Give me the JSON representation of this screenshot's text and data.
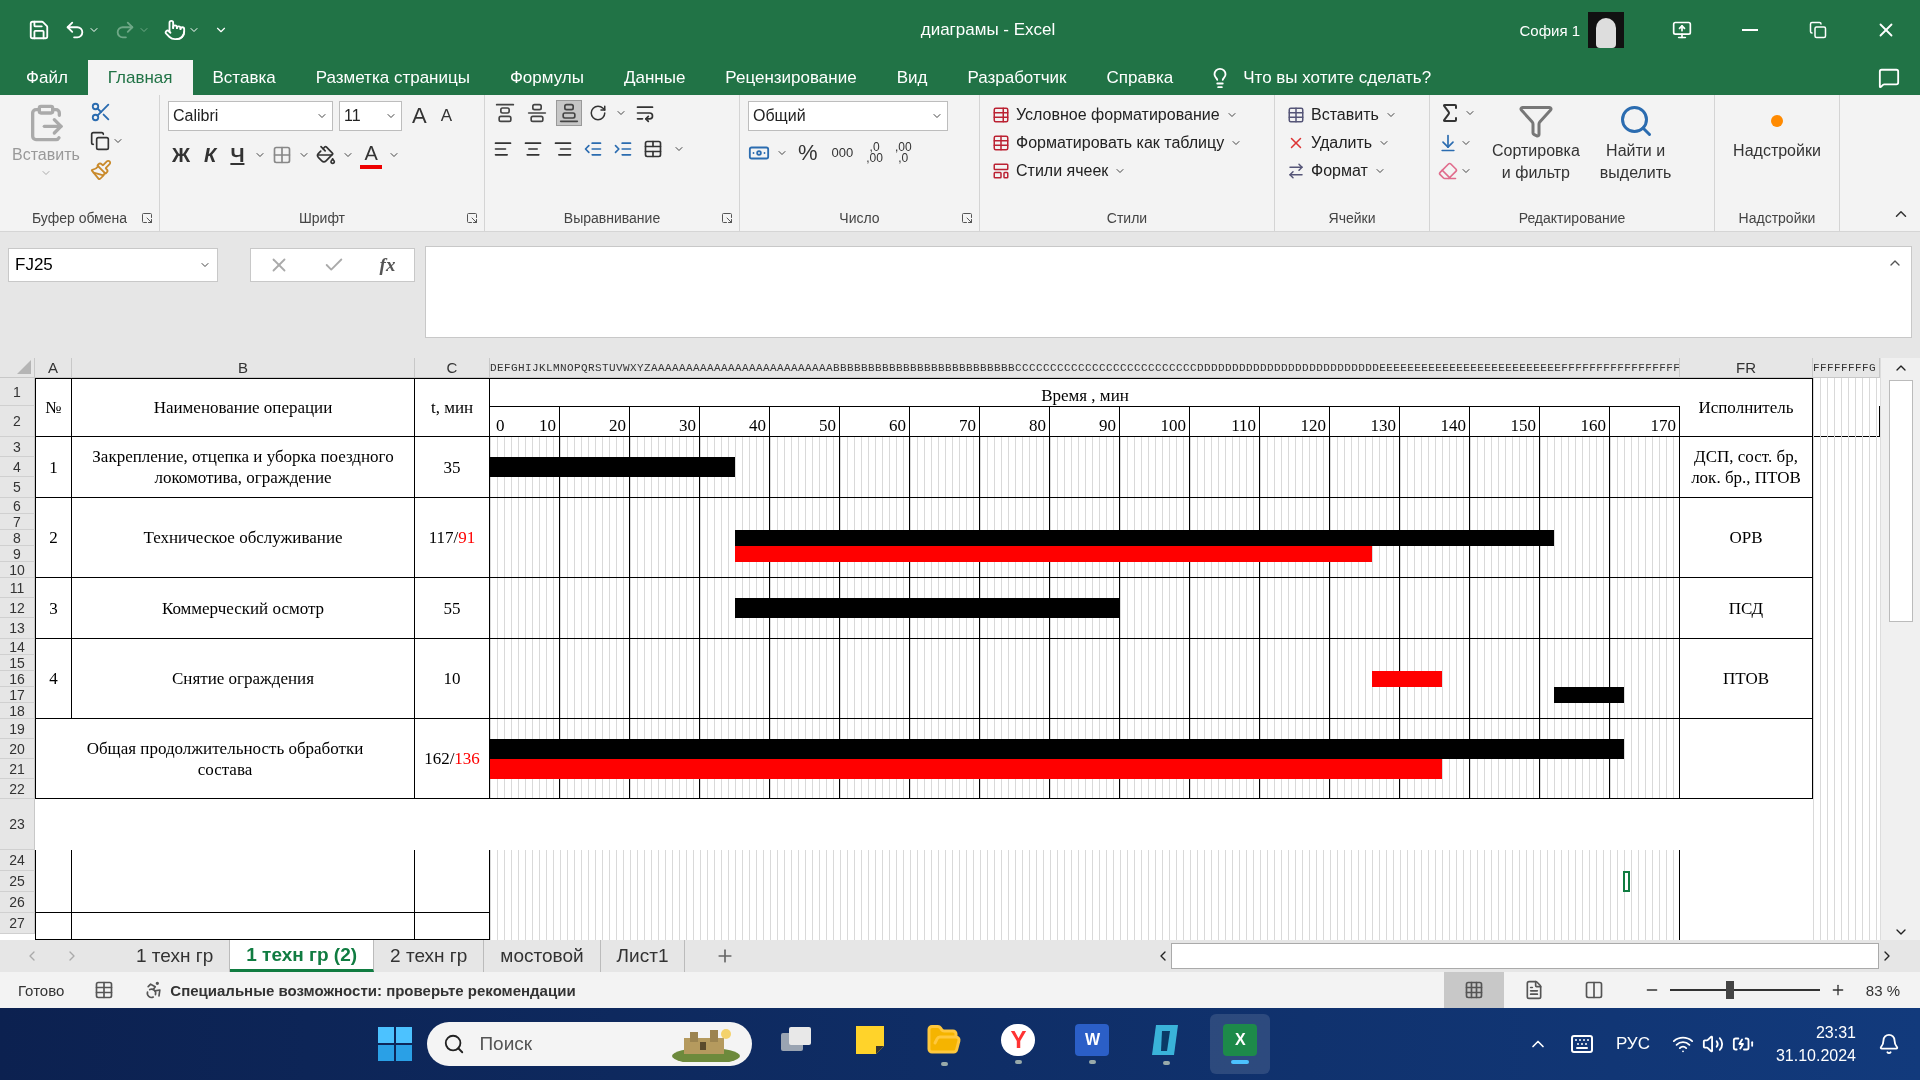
{
  "title_bar": {
    "title": "диаграмы  -  Excel",
    "user": "София 1"
  },
  "menu_tabs": [
    {
      "label": "Файл",
      "selected": false
    },
    {
      "label": "Главная",
      "selected": true
    },
    {
      "label": "Вставка",
      "selected": false
    },
    {
      "label": "Разметка страницы",
      "selected": false
    },
    {
      "label": "Формулы",
      "selected": false
    },
    {
      "label": "Данные",
      "selected": false
    },
    {
      "label": "Рецензирование",
      "selected": false
    },
    {
      "label": "Вид",
      "selected": false
    },
    {
      "label": "Разработчик",
      "selected": false
    },
    {
      "label": "Справка",
      "selected": false
    }
  ],
  "tell_me": "Что вы хотите сделать?",
  "ribbon": {
    "clipboard": {
      "label": "Буфер обмена",
      "paste": "Вставить"
    },
    "font": {
      "label": "Шрифт",
      "family": "Calibri",
      "size": "11",
      "grow": "A",
      "shrink": "A",
      "bold": "Ж",
      "italic": "К",
      "underline": "Ч",
      "color_letter": "A"
    },
    "alignment": {
      "label": "Выравнивание",
      "vertical": [
        {
          "selected": false
        },
        {
          "selected": false
        },
        {
          "selected": true
        }
      ]
    },
    "number": {
      "label": "Число",
      "format": "Общий",
      "percent": "%",
      "thousands": "000",
      "more_decimals": [
        ",0",
        ",00"
      ],
      "fewer_decimals": [
        ",00",
        ",0"
      ]
    },
    "styles": {
      "label": "Стили",
      "items": [
        "Условное форматирование",
        "Форматировать как таблицу",
        "Стили ячеек"
      ]
    },
    "cells": {
      "label": "Ячейки",
      "items": [
        "Вставить",
        "Удалить",
        "Формат"
      ]
    },
    "editing": {
      "label": "Редактирование",
      "sort": [
        "Сортировка",
        "и фильтр"
      ],
      "find": [
        "Найти и",
        "выделить"
      ]
    },
    "addins": {
      "label": "Надстройки",
      "button": "Надстройки"
    }
  },
  "formula_bar": {
    "name_box": "FJ25",
    "fx": "fx"
  },
  "sheet": {
    "column_headers": {
      "a": "A",
      "b": "B",
      "c": "C",
      "timeline": "DEFGHIJKLMNOPQRSTUVWXYZAAAAAAAAAAAAAAAAAAAAAAAAAABBBBBBBBBBBBBBBBBBBBBBBBBBCCCCCCCCCCCCCCCCCCCCCCCCCCDDDDDDDDDDDDDDDDDDDDDDDDDDEEEEEEEEEEEEEEEEEEEEEEEEEEFFFFFFFFFFFFFFFFF",
      "fr": "FR",
      "rest": "FFFFFFFFG"
    },
    "row_numbers": [
      "1",
      "2",
      "3",
      "4",
      "5",
      "6",
      "7",
      "8",
      "9",
      "10",
      "11",
      "12",
      "13",
      "14",
      "15",
      "16",
      "17",
      "18",
      "19",
      "20",
      "21",
      "22",
      "23",
      "24",
      "25",
      "26",
      "27"
    ],
    "headers": {
      "number": "№",
      "operation": "Наименование операции",
      "duration": "t, мин",
      "executor": "Исполнитель"
    },
    "rows": [
      {
        "kind": "operation",
        "number": "1",
        "operation": "Закрепление, отцепка и уборка поездного локомотива, ограждение",
        "duration": [
          {
            "text": "35",
            "color": "#000000"
          }
        ],
        "executor": "ДСП, сост. бр, лок. бр., ПТОВ"
      },
      {
        "kind": "operation",
        "number": "2",
        "operation": "Техническое обслуживание",
        "duration": [
          {
            "text": "117/",
            "color": "#000000"
          },
          {
            "text": "91",
            "color": "#ff0000"
          }
        ],
        "executor": "ОРВ"
      },
      {
        "kind": "operation",
        "number": "3",
        "operation": "Коммерческий осмотр",
        "duration": [
          {
            "text": "55",
            "color": "#000000"
          }
        ],
        "executor": "ПСД"
      },
      {
        "kind": "operation",
        "number": "4",
        "operation": "Снятие ограждения",
        "duration": [
          {
            "text": "10",
            "color": "#000000"
          }
        ],
        "executor": "ПТОВ"
      },
      {
        "kind": "total",
        "operation": "Общая продолжительность обработки состава",
        "duration": [
          {
            "text": "162/",
            "color": "#000000"
          },
          {
            "text": "136",
            "color": "#ff0000"
          }
        ]
      }
    ],
    "timeline": {
      "title": "Время , мин",
      "ticks": [
        "0",
        "10",
        "20",
        "30",
        "40",
        "50",
        "60",
        "70",
        "80",
        "90",
        "100",
        "110",
        "120",
        "130",
        "140",
        "150",
        "160",
        "170"
      ]
    }
  },
  "sheet_tabs": [
    {
      "label": "1 техн гр",
      "selected": false
    },
    {
      "label": "1 техн гр (2)",
      "selected": true
    },
    {
      "label": "2 техн гр",
      "selected": false
    },
    {
      "label": "мостовой",
      "selected": false
    },
    {
      "label": "Лист1",
      "selected": false
    }
  ],
  "status_bar": {
    "ready": "Готово",
    "accessibility": "Специальные возможности: проверьте рекомендации",
    "views": [
      {
        "kind": "normal",
        "selected": true
      },
      {
        "kind": "page_layout",
        "selected": false
      },
      {
        "kind": "page_break",
        "selected": false
      }
    ],
    "zoom": {
      "level": 0.4,
      "reading": "83 %"
    }
  },
  "taskbar": {
    "search": {
      "placeholder": "Поиск"
    },
    "apps": [
      {
        "kind": "taskview",
        "running": false,
        "selected": false
      },
      {
        "kind": "notes",
        "running": false,
        "selected": false
      },
      {
        "kind": "explorer",
        "running": true,
        "selected": false
      },
      {
        "kind": "browser",
        "letter": "Y",
        "running": true,
        "selected": false
      },
      {
        "kind": "word",
        "letter": "W",
        "running": true,
        "selected": false
      },
      {
        "kind": "app",
        "running": true,
        "selected": false
      },
      {
        "kind": "excel",
        "letter": "X",
        "running": true,
        "selected": true
      }
    ],
    "language": "РУС",
    "time": "23:31",
    "date": "31.10.2024"
  }
}
